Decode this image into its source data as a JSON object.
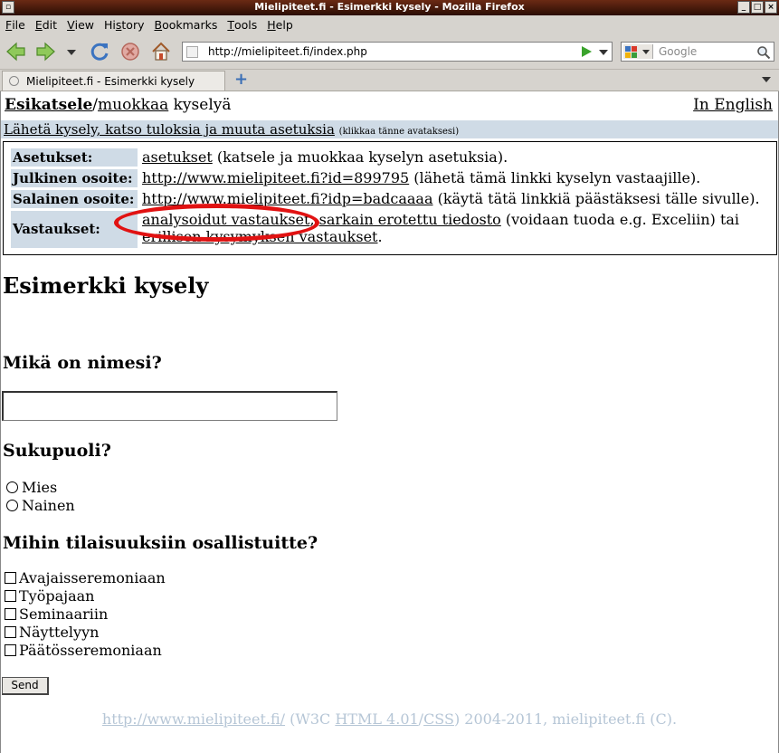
{
  "window": {
    "title": "Mielipiteet.fi - Esimerkki kysely - Mozilla Firefox"
  },
  "menu": [
    "File",
    "Edit",
    "View",
    "History",
    "Bookmarks",
    "Tools",
    "Help"
  ],
  "menu_underline": [
    "F",
    "E",
    "V",
    "s",
    "B",
    "T",
    "H"
  ],
  "nav": {
    "url": "http://mielipiteet.fi/index.php",
    "search_placeholder": "Google"
  },
  "tab": {
    "title": "Mielipiteet.fi - Esimerkki kysely"
  },
  "page": {
    "top": {
      "preview": "Esikatsele",
      "sep": "/",
      "edit": "muokkaa",
      "rest": " kyselyä",
      "english": "In English"
    },
    "band": {
      "link": "Lähetä kysely, katso tuloksia ja muuta asetuksia",
      "hint": "(klikkaa tänne avataksesi)"
    },
    "settings": {
      "settings_label": "Asetukset:",
      "settings_link": "asetukset",
      "settings_text": " (katsele ja muokkaa kyselyn asetuksia).",
      "public_label": "Julkinen osoite:",
      "public_link": "http://www.mielipiteet.fi?id=899795",
      "public_text": " (lähetä tämä linkki kyselyn vastaajille).",
      "secret_label": "Salainen osoite:",
      "secret_link": "http://www.mielipiteet.fi?idp=badcaaaa",
      "secret_text": " (käytä tätä linkkiä päästäksesi tälle sivulle).",
      "answers_label": "Vastaukset:",
      "answers_link1": "analysoidut vastaukset",
      "answers_sep": ", ",
      "answers_link2": "sarkain erotettu tiedosto",
      "answers_text": " (voidaan tuoda e.g. Exceliin) tai",
      "answers_link3": "erillisen kysymyksen vastaukset",
      "answers_end": "."
    },
    "survey_title": "Esimerkki kysely",
    "q1": "Mikä on nimesi?",
    "q1_value": "",
    "q2": "Sukupuoli?",
    "q2_options": [
      "Mies",
      "Nainen"
    ],
    "q3": "Mihin tilaisuuksiin osallistuitte?",
    "q3_options": [
      "Avajaisseremoniaan",
      "Työpajaan",
      "Seminaariin",
      "Näyttelyyn",
      "Päätösseremoniaan"
    ],
    "send_label": "Send",
    "footer": {
      "link1": "http://www.mielipiteet.fi/",
      "text1": " (W3C ",
      "link2": "HTML 4.01",
      "slash": "/",
      "link3": "CSS",
      "text2": ") 2004-2011, mielipiteet.fi (C)."
    },
    "annotation_color": "#e11212"
  }
}
